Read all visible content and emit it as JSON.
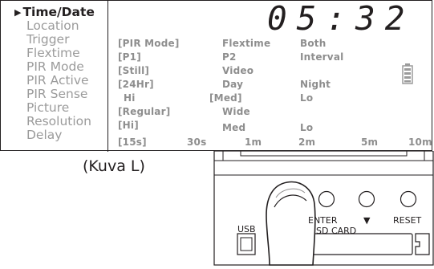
{
  "menu": {
    "items": [
      {
        "label": "Time/Date",
        "active": true
      },
      {
        "label": "Location"
      },
      {
        "label": "Trigger"
      },
      {
        "label": "Flextime"
      },
      {
        "label": "PIR Mode"
      },
      {
        "label": "PIR Active"
      },
      {
        "label": "PIR Sense"
      },
      {
        "label": "Picture"
      },
      {
        "label": "Resolution"
      },
      {
        "label": "Delay"
      }
    ],
    "active_marker": "▶"
  },
  "clock": {
    "time": "05:32"
  },
  "options": {
    "trigger": [
      "[PIR Mode]",
      "Flextime",
      "Both"
    ],
    "flextime": [
      "[P1]",
      "P2",
      "Interval"
    ],
    "pir_mode": [
      "[Still]",
      "Video"
    ],
    "pir_active": [
      "[24Hr]",
      "Day",
      "Night"
    ],
    "pir_sense": [
      "Hi",
      "[Med]",
      "Lo"
    ],
    "picture": [
      "[Regular]",
      "Wide"
    ],
    "resolution": [
      "[Hi]",
      "Med",
      "Lo"
    ],
    "delay": [
      "[15s]",
      "30s",
      "1m",
      "2m",
      "5m",
      "10m"
    ]
  },
  "battery": {
    "icon": "battery-icon",
    "level_fraction": 1.0
  },
  "caption": "(Kuva L)",
  "camera": {
    "buttons": [
      {
        "label": "ENTER",
        "icon": "circle-button"
      },
      {
        "label": "▼",
        "icon": "circle-button"
      },
      {
        "label": "RESET",
        "icon": "circle-button"
      }
    ],
    "usb_label": "USB",
    "sd_label": "SD CARD"
  },
  "colors": {
    "ink": "#231f20",
    "dim_text": "#9b9b9b"
  }
}
